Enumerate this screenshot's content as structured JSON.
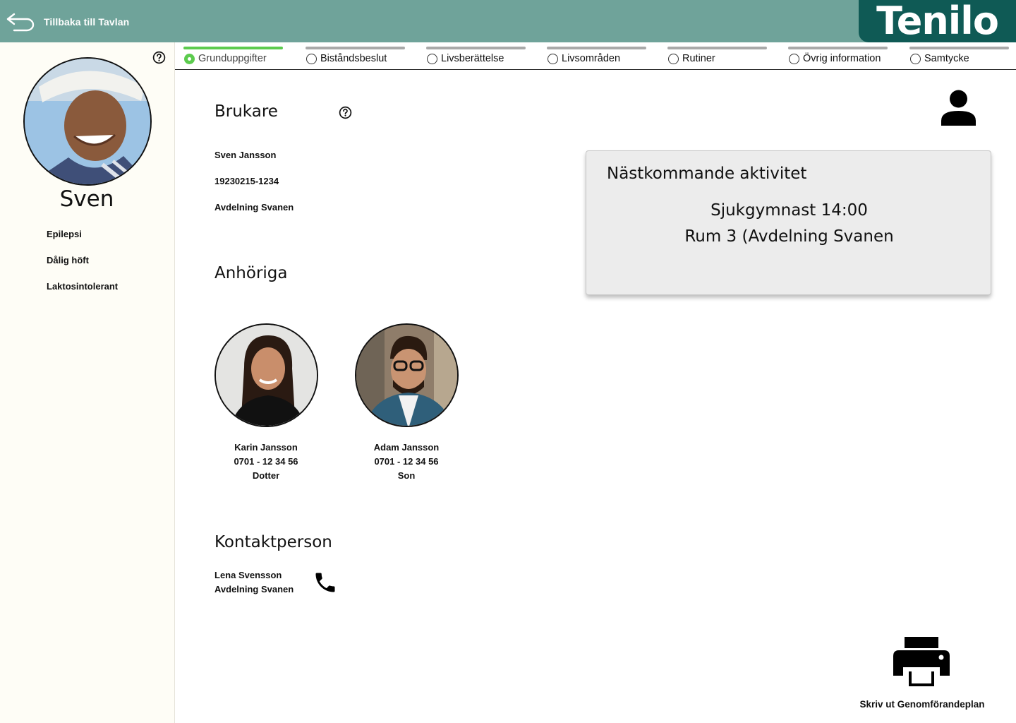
{
  "header": {
    "back_label": "Tillbaka till Tavlan",
    "logo_text": "Tenilo",
    "colors": {
      "topbar": "#6fa39a",
      "logo_bg": "#0f5a55"
    }
  },
  "sidebar": {
    "name": "Sven",
    "conditions": [
      "Epilepsi",
      "Dålig höft",
      "Laktosintolerant"
    ]
  },
  "tabs": [
    {
      "label": "Grunduppgifter",
      "active": true
    },
    {
      "label": "Biståndsbeslut",
      "active": false
    },
    {
      "label": "Livsberättelse",
      "active": false
    },
    {
      "label": "Livsområden",
      "active": false
    },
    {
      "label": "Rutiner",
      "active": false
    },
    {
      "label": "Övrig information",
      "active": false
    },
    {
      "label": "Samtycke",
      "active": false
    }
  ],
  "brukare": {
    "title": "Brukare",
    "name": "Sven Jansson",
    "personal_number": "19230215-1234",
    "department": "Avdelning Svanen"
  },
  "activity": {
    "title": "Nästkommande aktivitet",
    "line1": "Sjukgymnast 14:00",
    "line2": "Rum 3 (Avdelning Svanen"
  },
  "relatives": {
    "title": "Anhöriga",
    "items": [
      {
        "name": "Karin Jansson",
        "phone": "0701 - 12 34 56",
        "relation": "Dotter"
      },
      {
        "name": "Adam Jansson",
        "phone": "0701 - 12 34 56",
        "relation": "Son"
      }
    ]
  },
  "contact": {
    "title": "Kontaktperson",
    "name": "Lena Svensson",
    "department": "Avdelning Svanen"
  },
  "print": {
    "label": "Skriv ut Genomförandeplan"
  },
  "icons": [
    "back-arrow-icon",
    "help-icon",
    "user-icon",
    "phone-icon",
    "printer-icon"
  ]
}
